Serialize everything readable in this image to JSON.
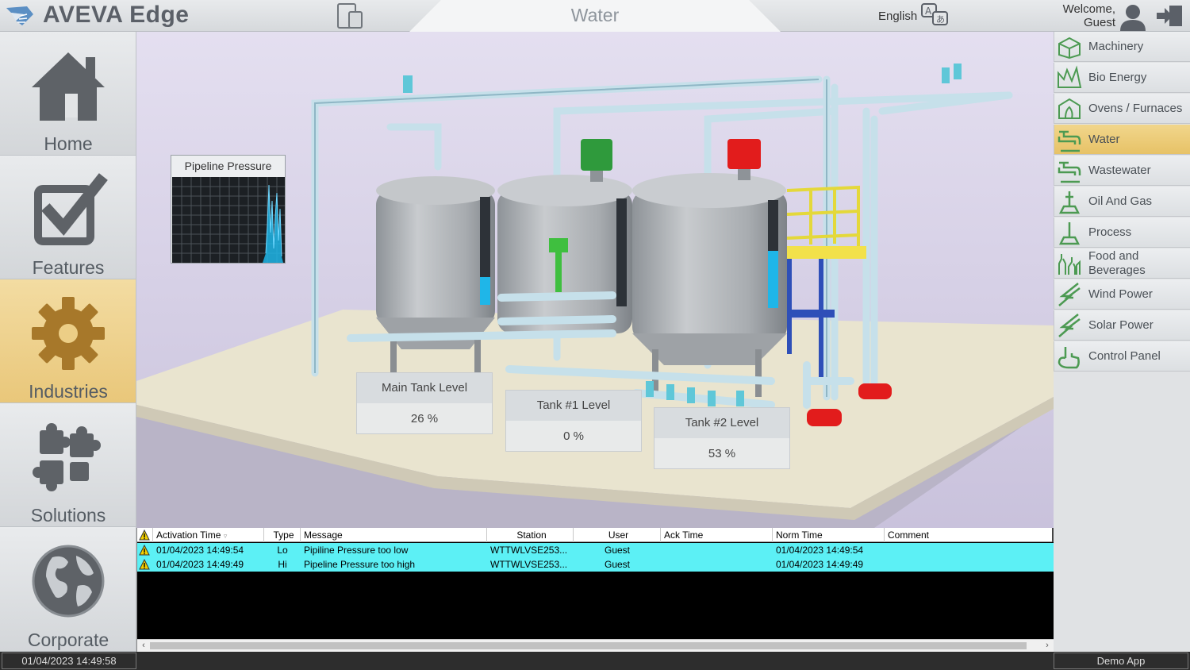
{
  "header": {
    "brand": "AVEVA Edge",
    "page_title": "Water",
    "language": "English",
    "welcome_line1": "Welcome,",
    "welcome_line2": "Guest"
  },
  "left_nav": {
    "items": [
      {
        "label": "Home",
        "icon": "home-icon"
      },
      {
        "label": "Features",
        "icon": "checkbox-icon"
      },
      {
        "label": "Industries",
        "icon": "gear-icon",
        "active": true
      },
      {
        "label": "Solutions",
        "icon": "puzzle-icon"
      },
      {
        "label": "Corporate",
        "icon": "globe-icon"
      }
    ]
  },
  "industries": {
    "items": [
      {
        "label": "Machinery"
      },
      {
        "label": "Bio Energy"
      },
      {
        "label": "Ovens / Furnaces"
      },
      {
        "label": "Water",
        "active": true
      },
      {
        "label": "Wastewater"
      },
      {
        "label": "Oil And Gas"
      },
      {
        "label": "Process"
      },
      {
        "label": "Food and Beverages"
      },
      {
        "label": "Wind Power"
      },
      {
        "label": "Solar Power"
      },
      {
        "label": "Control Panel"
      }
    ]
  },
  "trend": {
    "title": "Pipeline Pressure"
  },
  "levels": [
    {
      "title": "Main Tank Level",
      "value": "26 %",
      "fraction": 0.26
    },
    {
      "title": "Tank #1 Level",
      "value": "0 %",
      "fraction": 0.0
    },
    {
      "title": "Tank #2 Level",
      "value": "53 %",
      "fraction": 0.53
    }
  ],
  "alarm_table": {
    "columns": [
      "Activation Time",
      "Type",
      "Message",
      "Station",
      "User",
      "Ack Time",
      "Norm Time",
      "Comment"
    ],
    "rows": [
      {
        "activation": "01/04/2023 14:49:54",
        "type": "Lo",
        "message": "Pipiline Pressure too low",
        "station": "WTTWLVSE253...",
        "user": "Guest",
        "ack": "",
        "norm": "01/04/2023 14:49:54",
        "comment": ""
      },
      {
        "activation": "01/04/2023 14:49:49",
        "type": "Hi",
        "message": "Pipeline Pressure too high",
        "station": "WTTWLVSE253...",
        "user": "Guest",
        "ack": "",
        "norm": "01/04/2023 14:49:49",
        "comment": ""
      }
    ]
  },
  "status": {
    "clock": "01/04/2023 14:49:58",
    "mode": "Demo App"
  },
  "colors": {
    "accent": "#e9c77a",
    "alarm_row": "#5cf0f5",
    "level_fill": "#1fb6e8"
  }
}
